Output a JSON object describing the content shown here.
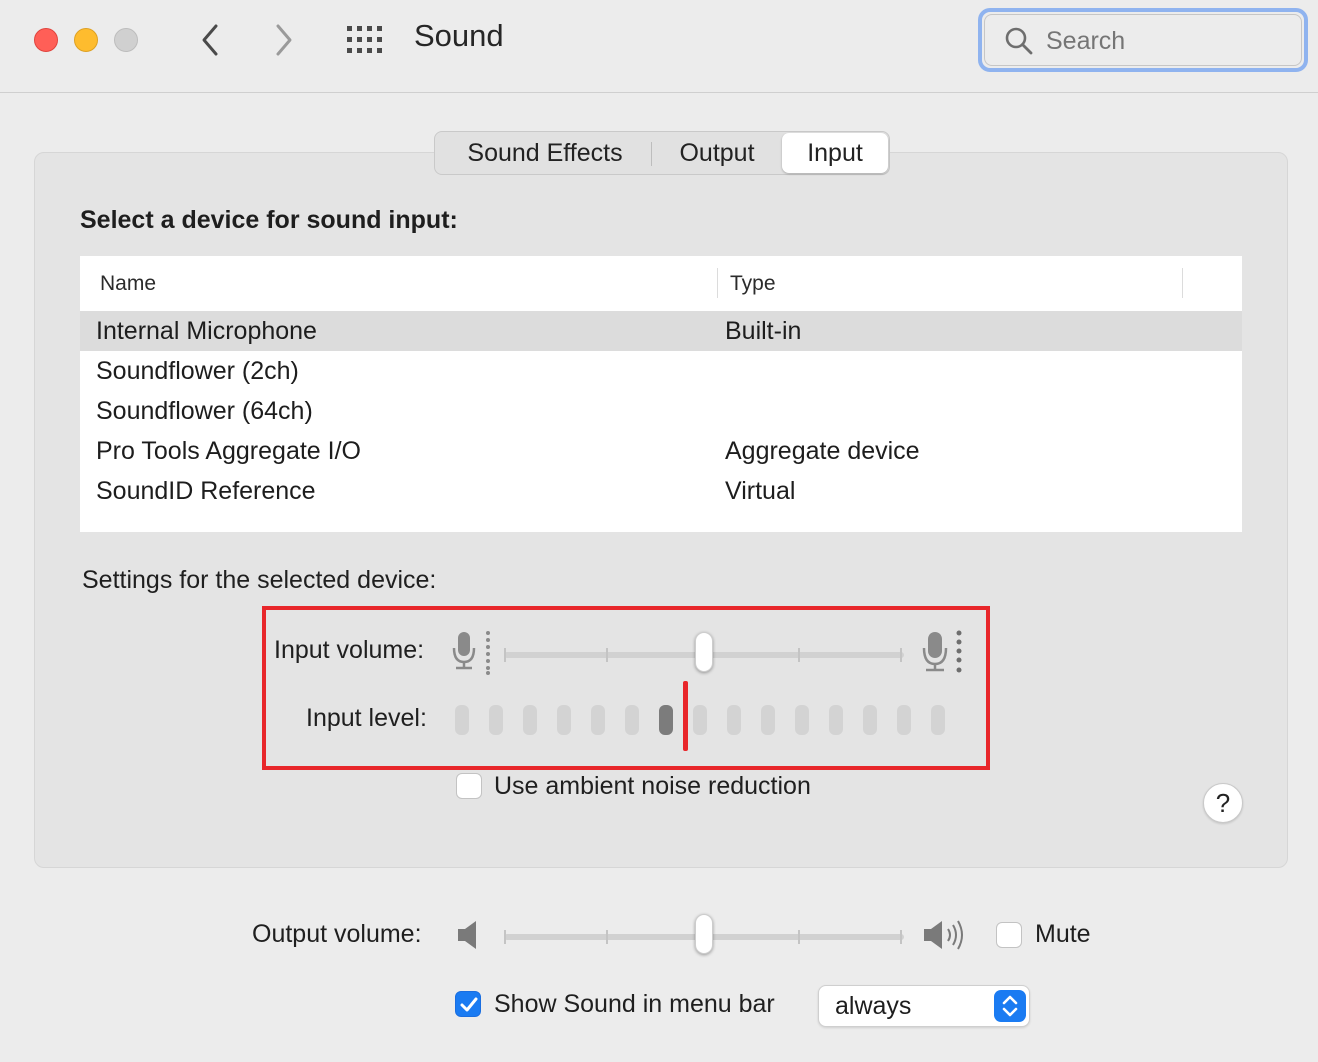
{
  "window": {
    "title": "Sound",
    "search_placeholder": "Search"
  },
  "tabs": [
    {
      "label": "Sound Effects",
      "selected": false
    },
    {
      "label": "Output",
      "selected": false
    },
    {
      "label": "Input",
      "selected": true
    }
  ],
  "device_section": {
    "heading": "Select a device for sound input:",
    "columns": [
      "Name",
      "Type"
    ],
    "rows": [
      {
        "name": "Internal Microphone",
        "type": "Built-in",
        "selected": true
      },
      {
        "name": "Soundflower (2ch)",
        "type": "",
        "selected": false
      },
      {
        "name": "Soundflower (64ch)",
        "type": "",
        "selected": false
      },
      {
        "name": "Pro Tools Aggregate I/O",
        "type": "Aggregate device",
        "selected": false
      },
      {
        "name": "SoundID Reference",
        "type": "Virtual",
        "selected": false
      }
    ]
  },
  "settings": {
    "heading": "Settings for the selected device:",
    "input_volume_label": "Input volume:",
    "input_volume_fraction": 0.5,
    "input_level_label": "Input level:",
    "input_level_segments_total": 15,
    "input_level_segments_lit": 7,
    "ambient_noise_label": "Use ambient noise reduction",
    "ambient_noise_checked": false
  },
  "help_label": "?",
  "output": {
    "volume_label": "Output volume:",
    "volume_fraction": 0.5,
    "mute_label": "Mute",
    "mute_checked": false
  },
  "menu_bar": {
    "label": "Show Sound in menu bar",
    "checked": true,
    "select_value": "always"
  },
  "colors": {
    "accent": "#1a7bf2",
    "highlight_frame": "#e8262a",
    "close": "#ff5f57",
    "minimize": "#febc2e"
  }
}
